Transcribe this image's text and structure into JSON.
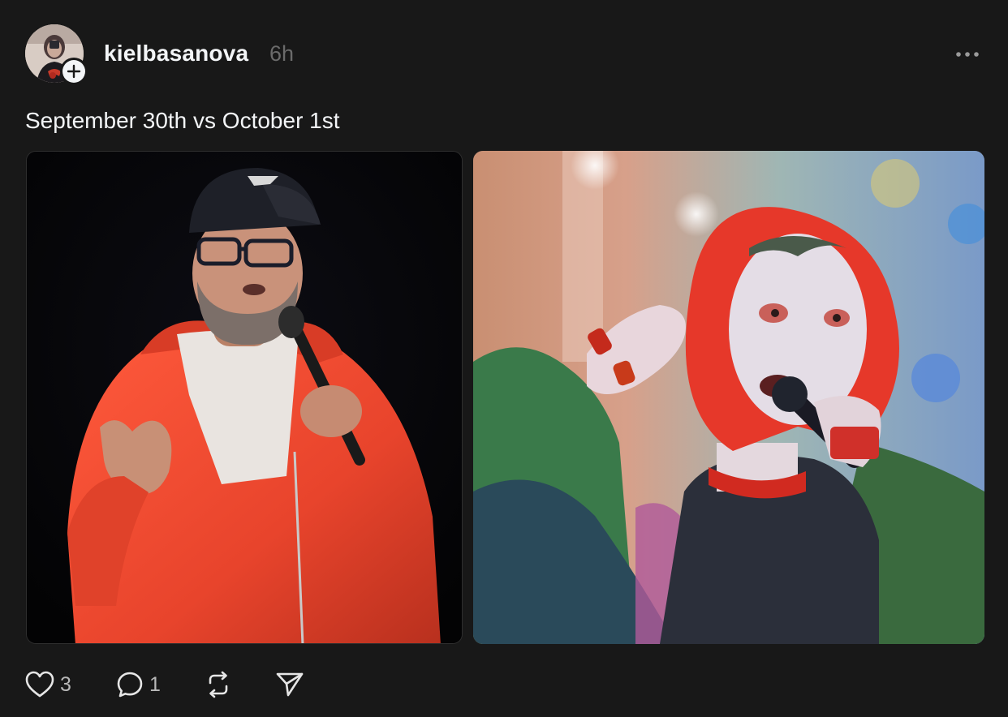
{
  "post": {
    "author": {
      "username": "kielbasanova",
      "avatar_icon": "avatar-photo",
      "follow_icon": "plus-icon"
    },
    "timestamp": "6h",
    "caption": "September 30th vs October 1st",
    "media": [
      {
        "icon": "photo-comedian-orange-hoodie"
      },
      {
        "icon": "photo-red-hair-singer"
      }
    ],
    "actions": {
      "like": {
        "icon": "heart-icon",
        "count": "3"
      },
      "reply": {
        "icon": "comment-icon",
        "count": "1"
      },
      "repost": {
        "icon": "repost-icon"
      },
      "share": {
        "icon": "send-icon"
      }
    },
    "more_icon": "ellipsis-icon"
  },
  "colors": {
    "background": "#181818",
    "text_primary": "#f3f5f7",
    "text_muted": "#6b6b6b",
    "count_text": "#b8b8b8"
  }
}
